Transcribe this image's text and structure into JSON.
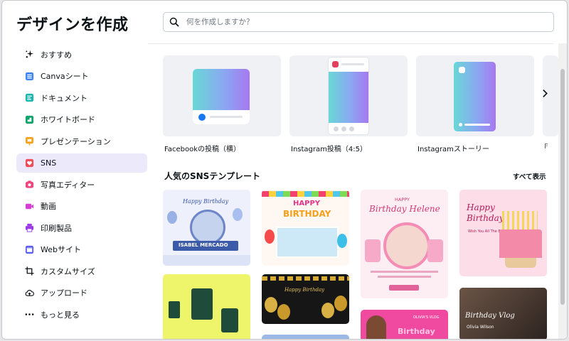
{
  "sidebar": {
    "title": "デザインを作成",
    "items": [
      {
        "label": "おすすめ",
        "icon": "sparkle-icon"
      },
      {
        "label": "Canvaシート",
        "icon": "sheet-icon"
      },
      {
        "label": "ドキュメント",
        "icon": "document-icon"
      },
      {
        "label": "ホワイトボード",
        "icon": "whiteboard-icon"
      },
      {
        "label": "プレゼンテーション",
        "icon": "presentation-icon"
      },
      {
        "label": "SNS",
        "icon": "heart-icon",
        "active": true
      },
      {
        "label": "写真エディター",
        "icon": "camera-icon"
      },
      {
        "label": "動画",
        "icon": "video-icon"
      },
      {
        "label": "印刷製品",
        "icon": "printer-icon"
      },
      {
        "label": "Webサイト",
        "icon": "website-icon"
      },
      {
        "label": "カスタムサイズ",
        "icon": "crop-icon"
      },
      {
        "label": "アップロード",
        "icon": "cloud-upload-icon"
      },
      {
        "label": "もっと見る",
        "icon": "more-dots-icon"
      }
    ]
  },
  "search": {
    "placeholder": "何を作成しますか？"
  },
  "categories": [
    {
      "label": "Facebookの投稿（横）"
    },
    {
      "label": "Instagram投稿（4:5）"
    },
    {
      "label": "Instagramストーリー"
    },
    {
      "label": "F"
    }
  ],
  "section": {
    "title": "人気のSNSテンプレート",
    "see_all": "すべて表示"
  },
  "templates": {
    "t1": {
      "line1": "Happy Birthday",
      "name": "ISABEL MERCADO"
    },
    "t2": {
      "line1": "HAPPY",
      "line2": "BIRTHDAY"
    },
    "t3": {
      "line1": "HAPPY",
      "line2": "Birthday Helene"
    },
    "t4": {
      "line1": "Happy",
      "line2": "Birthday",
      "line3": "Wish You All The Best."
    },
    "t6": {
      "line1": "Happy Birthday"
    },
    "t7": {
      "line1": "OLIVIA'S VLOG",
      "line2": "Birthday"
    },
    "t8": {
      "line1": "Birthday Vlog",
      "line2": "Olivia Wilson"
    }
  },
  "colors": {
    "accent": "#8b3dff",
    "active_bg": "#ece9fb"
  }
}
